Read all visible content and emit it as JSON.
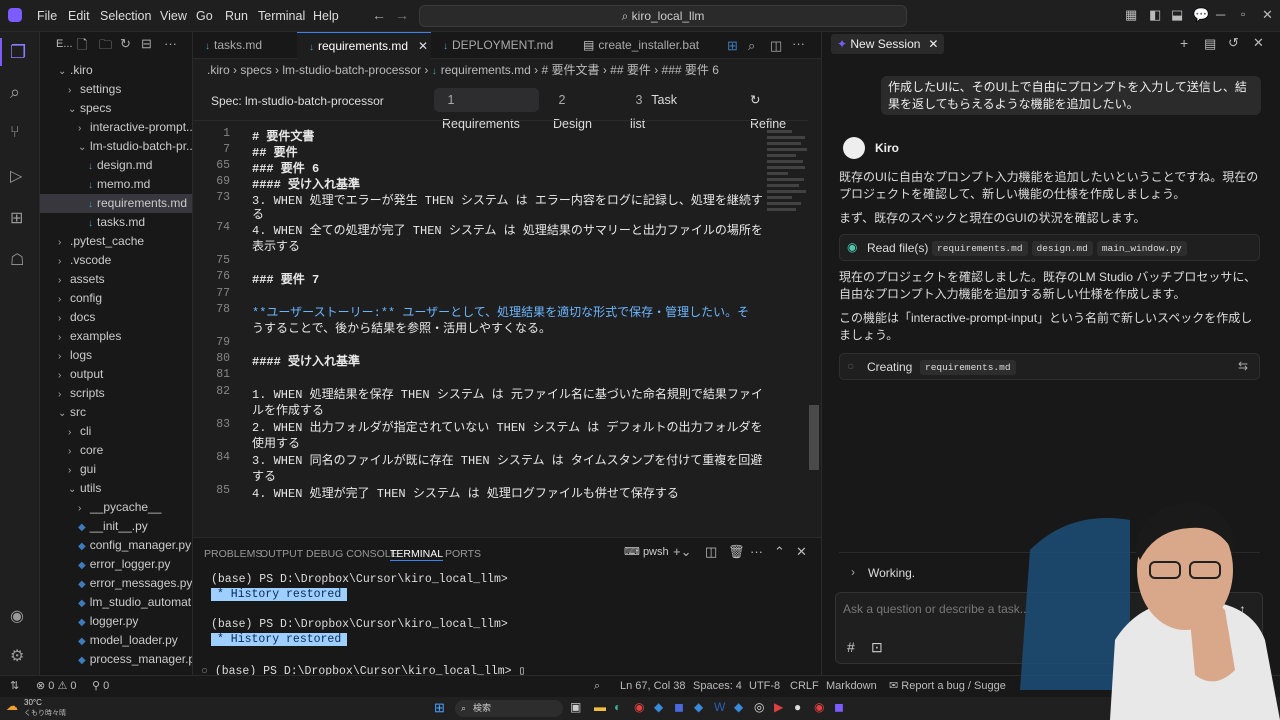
{
  "titlebar": {
    "menus": [
      "File",
      "Edit",
      "Selection",
      "View",
      "Go",
      "Run",
      "Terminal",
      "Help"
    ],
    "search": "kiro_local_llm"
  },
  "sidebar": {
    "header": "E...",
    "items": [
      {
        "label": ".kiro",
        "indent": 1,
        "chev": "⌄"
      },
      {
        "label": "settings",
        "indent": 2,
        "chev": "›"
      },
      {
        "label": "specs",
        "indent": 2,
        "chev": "⌄"
      },
      {
        "label": "interactive-prompt...",
        "indent": 3,
        "chev": "›"
      },
      {
        "label": "lm-studio-batch-pr...",
        "indent": 3,
        "chev": "⌄"
      },
      {
        "label": "design.md",
        "indent": 4,
        "type": "md"
      },
      {
        "label": "memo.md",
        "indent": 4,
        "type": "md"
      },
      {
        "label": "requirements.md",
        "indent": 4,
        "type": "md",
        "selected": true
      },
      {
        "label": "tasks.md",
        "indent": 4,
        "type": "md"
      },
      {
        "label": ".pytest_cache",
        "indent": 1,
        "chev": "›"
      },
      {
        "label": ".vscode",
        "indent": 1,
        "chev": "›"
      },
      {
        "label": "assets",
        "indent": 1,
        "chev": "›"
      },
      {
        "label": "config",
        "indent": 1,
        "chev": "›"
      },
      {
        "label": "docs",
        "indent": 1,
        "chev": "›"
      },
      {
        "label": "examples",
        "indent": 1,
        "chev": "›"
      },
      {
        "label": "logs",
        "indent": 1,
        "chev": "›"
      },
      {
        "label": "output",
        "indent": 1,
        "chev": "›"
      },
      {
        "label": "scripts",
        "indent": 1,
        "chev": "›"
      },
      {
        "label": "src",
        "indent": 1,
        "chev": "⌄"
      },
      {
        "label": "cli",
        "indent": 2,
        "chev": "›"
      },
      {
        "label": "core",
        "indent": 2,
        "chev": "›"
      },
      {
        "label": "gui",
        "indent": 2,
        "chev": "›"
      },
      {
        "label": "utils",
        "indent": 2,
        "chev": "⌄"
      },
      {
        "label": "__pycache__",
        "indent": 3,
        "chev": "›"
      },
      {
        "label": "__init__.py",
        "indent": 3,
        "type": "py"
      },
      {
        "label": "config_manager.py",
        "indent": 3,
        "type": "py"
      },
      {
        "label": "error_logger.py",
        "indent": 3,
        "type": "py"
      },
      {
        "label": "error_messages.py",
        "indent": 3,
        "type": "py"
      },
      {
        "label": "lm_studio_automat...",
        "indent": 3,
        "type": "py"
      },
      {
        "label": "logger.py",
        "indent": 3,
        "type": "py"
      },
      {
        "label": "model_loader.py",
        "indent": 3,
        "type": "py"
      },
      {
        "label": "process_manager.py",
        "indent": 3,
        "type": "py"
      }
    ]
  },
  "tabs": [
    "tasks.md",
    "requirements.md",
    "DEPLOYMENT.md",
    "create_installer.bat"
  ],
  "breadcrumb": [
    ".kiro",
    "specs",
    "lm-studio-batch-processor",
    "requirements.md",
    "# 要件文書",
    "## 要件",
    "### 要件 6"
  ],
  "spec": {
    "title": "Spec: lm-studio-batch-processor",
    "tabs": [
      {
        "num": "1",
        "label": "Requirements"
      },
      {
        "num": "2",
        "label": "Design"
      },
      {
        "num": "3",
        "label": "Task list"
      }
    ],
    "refine": "Refine"
  },
  "code": [
    {
      "ln": "1",
      "text": "# 要件文書",
      "cls": "hd"
    },
    {
      "ln": "7",
      "text": "## 要件",
      "cls": "hd"
    },
    {
      "ln": "65",
      "text": "### 要件 6",
      "cls": "hd"
    },
    {
      "ln": "69",
      "text": "#### 受け入れ基準",
      "cls": "hd"
    },
    {
      "ln": "73",
      "text": "3. WHEN 処理でエラーが発生 THEN システム は エラー内容をログに記録し、処理を継続す",
      "cls": ""
    },
    {
      "ln": "",
      "text": "る",
      "cls": ""
    },
    {
      "ln": "74",
      "text": "4. WHEN 全ての処理が完了 THEN システム は 処理結果のサマリーと出力ファイルの場所を",
      "cls": ""
    },
    {
      "ln": "",
      "text": "表示する",
      "cls": ""
    },
    {
      "ln": "75",
      "text": "",
      "cls": ""
    },
    {
      "ln": "76",
      "text": "### 要件 7",
      "cls": "hd"
    },
    {
      "ln": "77",
      "text": "",
      "cls": ""
    },
    {
      "ln": "78",
      "text": "**ユーザーストーリー:** ユーザーとして、処理結果を適切な形式で保存・管理したい。そ",
      "cls": "story"
    },
    {
      "ln": "",
      "text": "うすることで、後から結果を参照・活用しやすくなる。",
      "cls": ""
    },
    {
      "ln": "79",
      "text": "",
      "cls": ""
    },
    {
      "ln": "80",
      "text": "#### 受け入れ基準",
      "cls": "hd"
    },
    {
      "ln": "81",
      "text": "",
      "cls": ""
    },
    {
      "ln": "82",
      "text": "1. WHEN 処理結果を保存 THEN システム は 元ファイル名に基づいた命名規則で結果ファイ",
      "cls": ""
    },
    {
      "ln": "",
      "text": "ルを作成する",
      "cls": ""
    },
    {
      "ln": "83",
      "text": "2. WHEN 出力フォルダが指定されていない THEN システム は デフォルトの出力フォルダを",
      "cls": ""
    },
    {
      "ln": "",
      "text": "使用する",
      "cls": ""
    },
    {
      "ln": "84",
      "text": "3. WHEN 同名のファイルが既に存在 THEN システム は タイムスタンプを付けて重複を回避",
      "cls": ""
    },
    {
      "ln": "",
      "text": "する",
      "cls": ""
    },
    {
      "ln": "85",
      "text": "4. WHEN 処理が完了 THEN システム は 処理ログファイルも併せて保存する",
      "cls": ""
    }
  ],
  "panel": {
    "tabs": [
      "PROBLEMS",
      "OUTPUT",
      "DEBUG CONSOLE",
      "TERMINAL",
      "PORTS"
    ],
    "shell": "pwsh",
    "lines": [
      "(base) PS D:\\Dropbox\\Cursor\\kiro_local_llm>",
      "*  History restored",
      "(base) PS D:\\Dropbox\\Cursor\\kiro_local_llm>",
      "*  History restored",
      "(base) PS D:\\Dropbox\\Cursor\\kiro_local_llm>"
    ]
  },
  "chat": {
    "session": "New Session",
    "user_msg": "作成したUIに、そのUI上で自由にプロンプトを入力して送信し、結果を返してもらえるような機能を追加したい。",
    "bot": "Kiro",
    "p1": "既存のUIに自由なプロンプト入力機能を追加したいということですね。現在のプロジェクトを確認して、新しい機能の仕様を作成しましょう。",
    "p2": "まず、既存のスペックと現在のGUIの状況を確認します。",
    "readfiles": "Read file(s)",
    "files": [
      "requirements.md",
      "design.md",
      "main_window.py"
    ],
    "p3": "現在のプロジェクトを確認しました。既存のLM Studio バッチプロセッサに、自由なプロンプト入力機能を追加する新しい仕様を作成します。",
    "p4": "この機能は「interactive-prompt-input」という名前で新しいスペックを作成しましょう。",
    "creating": "Creating",
    "creating_file": "requirements.md",
    "working": "Working.",
    "placeholder": "Ask a question or describe a task..."
  },
  "status": {
    "errors": "0",
    "warnings": "0",
    "ports": "0",
    "cursor": "Ln 67, Col 38",
    "spaces": "Spaces: 4",
    "enc": "UTF-8",
    "eol": "CRLF",
    "lang": "Markdown",
    "report": "Report a bug / Sugge"
  },
  "taskbar": {
    "weather": "30°C",
    "weather_sub": "くもり時々晴",
    "search": "検索"
  },
  "colors": {
    "accent": "#7c5cff",
    "tab_active": "#3b82f6",
    "term_hl": "#9ecfff"
  }
}
